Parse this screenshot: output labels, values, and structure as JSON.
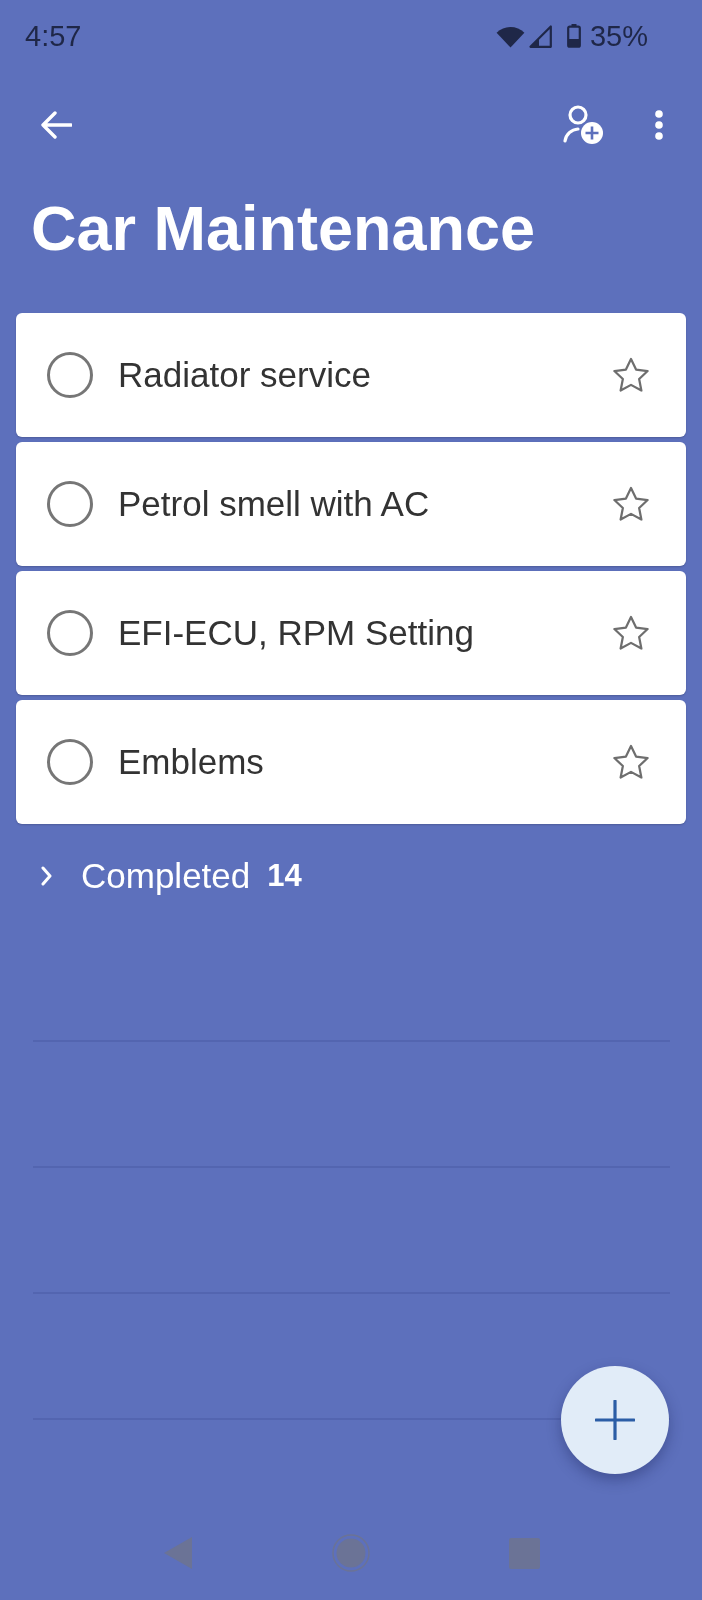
{
  "status_bar": {
    "time": "4:57",
    "battery": "35%"
  },
  "title": "Car Maintenance",
  "tasks": [
    {
      "title": "Radiator service",
      "completed": false,
      "starred": false
    },
    {
      "title": "Petrol smell with AC",
      "completed": false,
      "starred": false
    },
    {
      "title": "EFI-ECU, RPM Setting",
      "completed": false,
      "starred": false
    },
    {
      "title": "Emblems",
      "completed": false,
      "starred": false
    }
  ],
  "completed_section": {
    "label": "Completed",
    "count": "14",
    "expanded": false
  }
}
